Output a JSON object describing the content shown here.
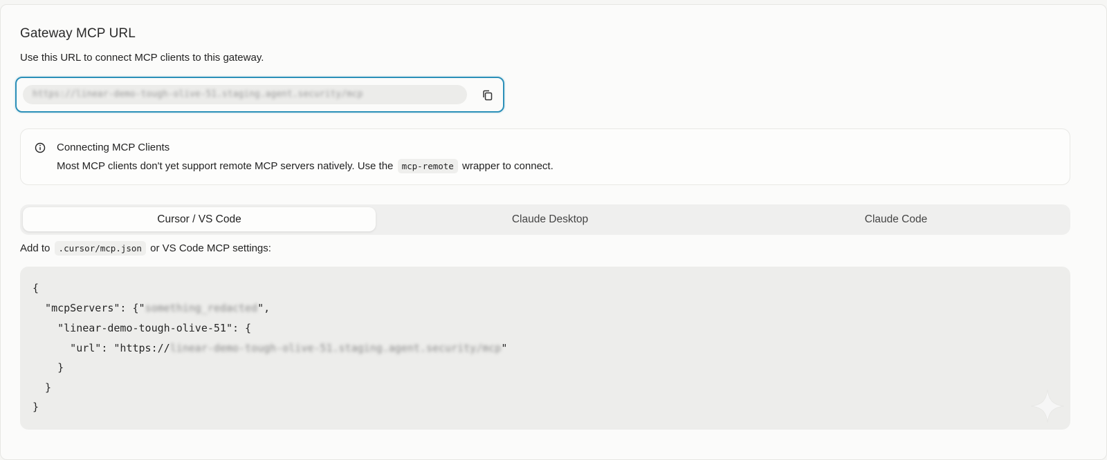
{
  "section": {
    "title": "Gateway MCP URL",
    "subtitle": "Use this URL to connect MCP clients to this gateway."
  },
  "url_field": {
    "value": "https://linear-demo-tough-olive-51.staging.agent.security/mcp",
    "copy_icon": "copy-icon"
  },
  "info": {
    "icon": "info-circle-icon",
    "title": "Connecting MCP Clients",
    "body_before": "Most MCP clients don't yet support remote MCP servers natively. Use the",
    "body_code": "mcp-remote",
    "body_after": "wrapper to connect."
  },
  "tabs": [
    {
      "label": "Cursor / VS Code",
      "active": true
    },
    {
      "label": "Claude Desktop",
      "active": false
    },
    {
      "label": "Claude Code",
      "active": false
    }
  ],
  "instruction": {
    "before": "Add to",
    "code": ".cursor/mcp.json",
    "after": "or VS Code MCP settings:"
  },
  "code": {
    "line1": "{",
    "line2_a": "  \"mcpServers\": {\"",
    "line2_blur": "something_redacted",
    "line2_b": "\",",
    "line3": "    \"linear-demo-tough-olive-51\": {",
    "line4_a": "      \"url\": \"https://",
    "line4_blur": "linear-demo-tough-olive-51.staging.agent.security/mcp",
    "line4_b": "\"",
    "line5": "    }",
    "line6": "  }",
    "line7": "}"
  },
  "colors": {
    "accent": "#2a8fb8",
    "background": "#fbfbfa",
    "code_bg": "#ededeb"
  }
}
